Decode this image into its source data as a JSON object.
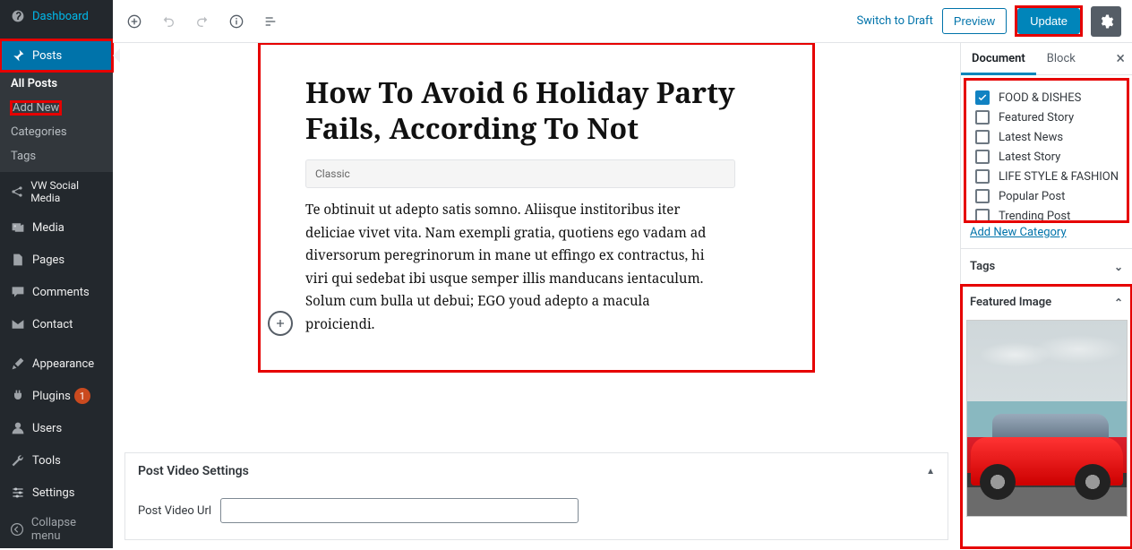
{
  "sidebar": {
    "dashboard": "Dashboard",
    "posts": "Posts",
    "all_posts": "All Posts",
    "add_new": "Add New",
    "categories": "Categories",
    "tags": "Tags",
    "vw_social": "VW Social Media",
    "media": "Media",
    "pages": "Pages",
    "comments": "Comments",
    "contact": "Contact",
    "appearance": "Appearance",
    "plugins": "Plugins",
    "plugins_count": "1",
    "users": "Users",
    "tools": "Tools",
    "settings": "Settings",
    "collapse": "Collapse menu"
  },
  "topbar": {
    "switch_draft": "Switch to Draft",
    "preview": "Preview",
    "update": "Update"
  },
  "post": {
    "title": "How To Avoid 6 Holiday Party Fails, According To Not",
    "classic_label": "Classic",
    "body": "Te obtinuit ut adepto satis somno. Aliisque institoribus iter deliciae vivet vita. Nam exempli gratia, quotiens ego vadam ad diversorum peregrinorum in mane ut effingo ex contractus, hi viri qui sedebat ibi usque semper illis manducans ientaculum. Solum cum bulla ut debui; EGO youd adepto a macula proiciendi."
  },
  "metabox": {
    "title": "Post Video Settings",
    "url_label": "Post Video Url"
  },
  "rightpanel": {
    "tab_document": "Document",
    "tab_block": "Block",
    "categories": [
      {
        "label": "FOOD & DISHES",
        "checked": true
      },
      {
        "label": "Featured Story",
        "checked": false
      },
      {
        "label": "Latest News",
        "checked": false
      },
      {
        "label": "Latest Story",
        "checked": false
      },
      {
        "label": "LIFE STYLE & FASHION",
        "checked": false
      },
      {
        "label": "Popular Post",
        "checked": false
      },
      {
        "label": "Trending Post",
        "checked": false
      }
    ],
    "add_category": "Add New Category",
    "tags_heading": "Tags",
    "featured_heading": "Featured Image"
  }
}
